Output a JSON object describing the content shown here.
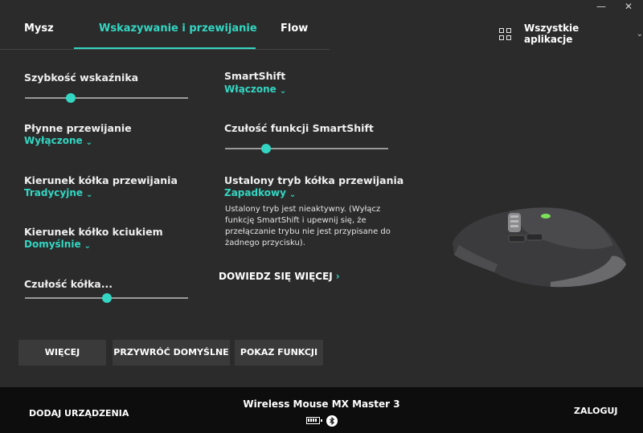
{
  "window": {
    "minimize": "—",
    "close": "✕"
  },
  "tabs": [
    {
      "label": "Mysz"
    },
    {
      "label": "Wskazywanie i przewijanie"
    },
    {
      "label": "Flow"
    }
  ],
  "apps": {
    "label": "Wszystkie aplikacje",
    "icon": "grid-icon"
  },
  "left_settings": {
    "pointer_speed": {
      "title": "Szybkość wskaźnika",
      "value_fraction": 0.28
    },
    "smooth_scroll": {
      "title": "Płynne przewijanie",
      "value": "Wyłączone"
    },
    "scroll_direction": {
      "title": "Kierunek kółka przewijania",
      "value": "Tradycyjne"
    },
    "thumb_direction": {
      "title": "Kierunek kółko kciukiem",
      "value": "Domyślnie"
    },
    "wheel_sensitivity": {
      "title": "Czułość kółka...",
      "value_fraction": 0.5
    }
  },
  "right_settings": {
    "smartshift": {
      "title": "SmartShift",
      "value": "Włączone"
    },
    "smartshift_sensitivity": {
      "title": "Czułość funkcji SmartShift",
      "value_fraction": 0.25
    },
    "fixed_mode": {
      "title": "Ustalony tryb kółka przewijania",
      "value": "Zapadkowy"
    },
    "note": "Ustalony tryb jest nieaktywny. (Wyłącz funkcję SmartShift i upewnij się, że przełączanie trybu nie jest przypisane do żadnego przycisku).",
    "learn_more": "DOWIEDZ SIĘ WIĘCEJ"
  },
  "buttons": {
    "more": "WIĘCEJ",
    "restore": "PRZYWRÓĆ DOMYŚLNE",
    "show_functions": "POKAZ FUNKCJI"
  },
  "footer": {
    "add_device": "DODAJ URZĄDZENIA",
    "device_name": "Wireless Mouse MX Master 3",
    "login": "ZALOGUJ",
    "battery_icon": "battery-icon",
    "bluetooth_icon": "bluetooth-icon"
  },
  "colors": {
    "accent": "#33d6c2",
    "background": "#2b2b2b",
    "footer": "#0d0d0d",
    "button": "#3a3a3a"
  }
}
